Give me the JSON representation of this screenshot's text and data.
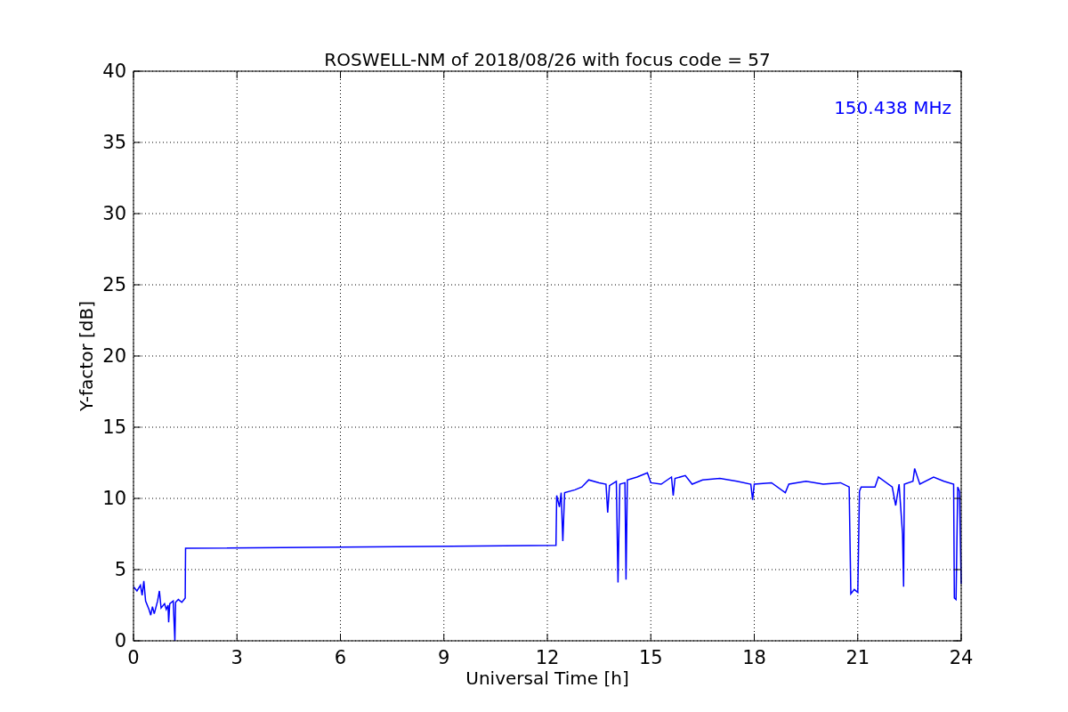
{
  "chart_data": {
    "type": "line",
    "title": "ROSWELL-NM of 2018/08/26 with focus code = 57",
    "xlabel": "Universal Time [h]",
    "ylabel": "Y-factor [dB]",
    "x": [
      0,
      0.1,
      0.2,
      0.25,
      0.3,
      0.35,
      0.45,
      0.5,
      0.55,
      0.6,
      0.7,
      0.75,
      0.8,
      0.9,
      0.95,
      1.0,
      1.02,
      1.05,
      1.15,
      1.2,
      1.22,
      1.3,
      1.4,
      1.5,
      1.51,
      12.25,
      12.27,
      12.35,
      12.4,
      12.45,
      12.5,
      12.8,
      13.0,
      13.2,
      13.5,
      13.7,
      13.75,
      13.8,
      14.0,
      14.05,
      14.1,
      14.25,
      14.28,
      14.32,
      14.6,
      14.9,
      15.0,
      15.3,
      15.6,
      15.65,
      15.7,
      16.0,
      16.2,
      16.5,
      17.0,
      17.5,
      17.9,
      17.95,
      18.0,
      18.5,
      18.9,
      19.0,
      19.5,
      20.0,
      20.5,
      20.75,
      20.8,
      20.9,
      21.0,
      21.05,
      21.1,
      21.5,
      21.6,
      22.0,
      22.1,
      22.2,
      22.3,
      22.33,
      22.35,
      22.6,
      22.65,
      22.8,
      23.2,
      23.5,
      23.78,
      23.8,
      23.85,
      23.9,
      23.95,
      24.0
    ],
    "series": [
      {
        "name": "150.438 MHz",
        "color": "#0000ff",
        "values": [
          3.8,
          3.5,
          3.9,
          3.2,
          4.2,
          2.8,
          2.2,
          1.8,
          2.4,
          1.9,
          2.8,
          3.5,
          2.3,
          2.6,
          2.2,
          2.5,
          1.3,
          2.6,
          2.8,
          0,
          2.7,
          2.9,
          2.7,
          3.0,
          6.5,
          6.7,
          10.2,
          9.4,
          10.4,
          7.0,
          10.4,
          10.6,
          10.8,
          11.3,
          11.1,
          11.0,
          9.0,
          10.9,
          11.2,
          4.1,
          11.0,
          11.1,
          4.3,
          11.3,
          11.5,
          11.8,
          11.1,
          11.0,
          11.5,
          10.2,
          11.4,
          11.6,
          11.0,
          11.3,
          11.4,
          11.2,
          11.0,
          9.9,
          11.0,
          11.1,
          10.4,
          11.0,
          11.2,
          11.0,
          11.1,
          10.8,
          3.3,
          3.6,
          3.4,
          10.5,
          10.8,
          10.8,
          11.5,
          10.8,
          9.5,
          11.0,
          7.5,
          3.8,
          11.0,
          11.2,
          12.1,
          11.0,
          11.5,
          11.2,
          11.0,
          3.0,
          2.9,
          10.8,
          10.5,
          4.0
        ]
      }
    ],
    "grid": true,
    "xlim": [
      0,
      24
    ],
    "ylim": [
      0,
      40
    ],
    "xticks": [
      0,
      3,
      6,
      9,
      12,
      15,
      18,
      21,
      24
    ],
    "yticks": [
      0,
      5,
      10,
      15,
      20,
      25,
      30,
      35,
      40
    ]
  }
}
